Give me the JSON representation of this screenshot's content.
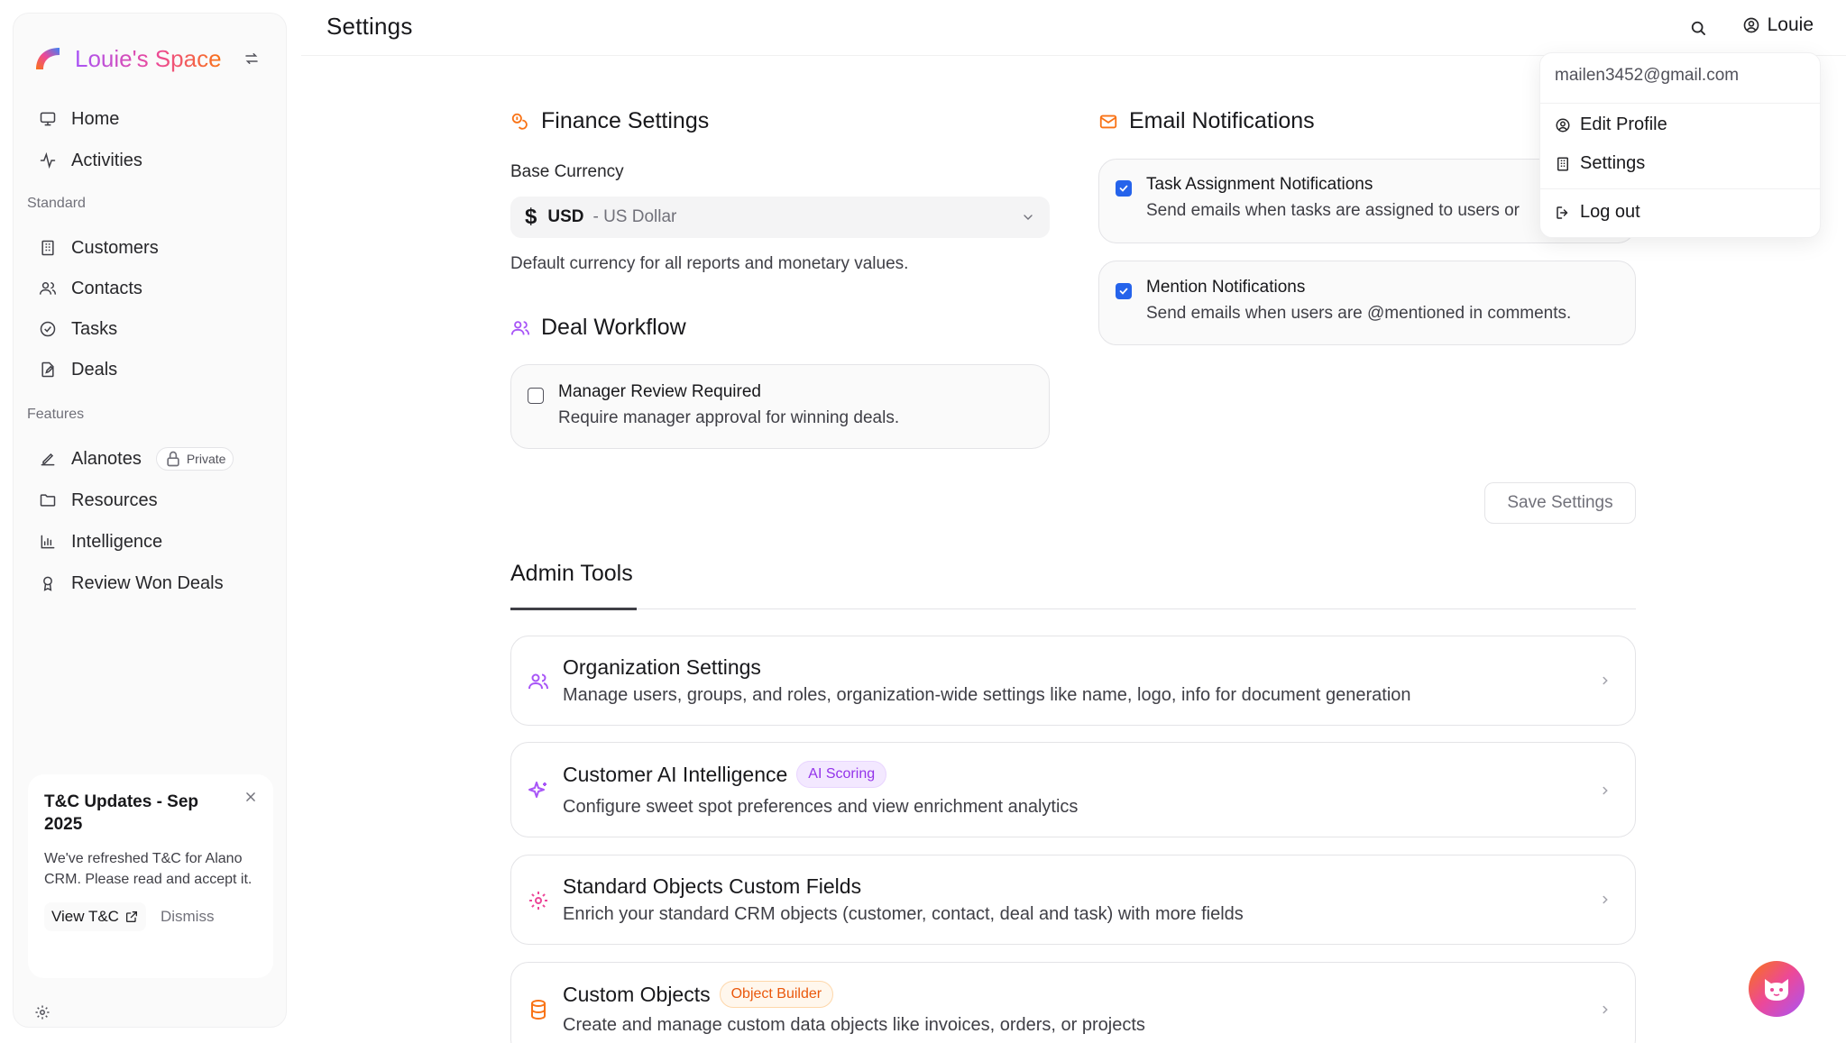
{
  "brand": {
    "name": "Louie's Space"
  },
  "sidebar": {
    "main_items": [
      {
        "label": "Home",
        "icon": "monitor-icon"
      },
      {
        "label": "Activities",
        "icon": "activity-icon"
      }
    ],
    "standard_label": "Standard",
    "standard_items": [
      {
        "label": "Customers",
        "icon": "building-icon"
      },
      {
        "label": "Contacts",
        "icon": "users-icon"
      },
      {
        "label": "Tasks",
        "icon": "check-circle-icon"
      },
      {
        "label": "Deals",
        "icon": "file-edit-icon"
      }
    ],
    "features_label": "Features",
    "features_items": [
      {
        "label": "Alanotes",
        "icon": "pen-icon",
        "badge": "Private"
      },
      {
        "label": "Resources",
        "icon": "folder-icon"
      },
      {
        "label": "Intelligence",
        "icon": "bar-chart-icon"
      },
      {
        "label": "Review Won Deals",
        "icon": "award-icon"
      }
    ]
  },
  "tc_card": {
    "title": "T&C Updates - Sep 2025",
    "body": "We've refreshed T&C for Alano CRM. Please read and accept it.",
    "view_label": "View T&C",
    "dismiss_label": "Dismiss"
  },
  "header": {
    "title": "Settings",
    "user_name": "Louie"
  },
  "finance": {
    "title": "Finance Settings",
    "base_currency_label": "Base Currency",
    "currency_symbol": "$",
    "currency_code": "USD",
    "currency_name": "- US Dollar",
    "helper": "Default currency for all reports and monetary values."
  },
  "deal_workflow": {
    "title": "Deal Workflow",
    "manager_review": {
      "title": "Manager Review Required",
      "desc": "Require manager approval for winning deals.",
      "checked": false
    }
  },
  "email_notifications": {
    "title": "Email Notifications",
    "task_assignment": {
      "title": "Task Assignment Notifications",
      "desc": "Send emails when tasks are assigned to users or",
      "checked": true
    },
    "mention": {
      "title": "Mention Notifications",
      "desc": "Send emails when users are @mentioned in comments.",
      "checked": true
    }
  },
  "save_label": "Save Settings",
  "admin_tools": {
    "tab_label": "Admin Tools",
    "cards": [
      {
        "title": "Organization Settings",
        "desc": "Manage users, groups, and roles, organization-wide settings like name, logo, info for document generation",
        "icon": "users-icon"
      },
      {
        "title": "Customer AI Intelligence",
        "badge": "AI Scoring",
        "desc": "Configure sweet spot preferences and view enrichment analytics",
        "icon": "sparkles-icon"
      },
      {
        "title": "Standard Objects Custom Fields",
        "desc": "Enrich your standard CRM objects (customer, contact, deal and task) with more fields",
        "icon": "gear-icon"
      },
      {
        "title": "Custom Objects",
        "badge": "Object Builder",
        "desc": "Create and manage custom data objects like invoices, orders, or projects",
        "icon": "database-icon"
      }
    ]
  },
  "user_menu": {
    "email": "mailen3452@gmail.com",
    "edit_profile": "Edit Profile",
    "settings": "Settings",
    "logout": "Log out"
  },
  "colors": {
    "accent_orange": "#f97316",
    "accent_purple": "#a855f7",
    "checkbox_blue": "#2563eb"
  }
}
